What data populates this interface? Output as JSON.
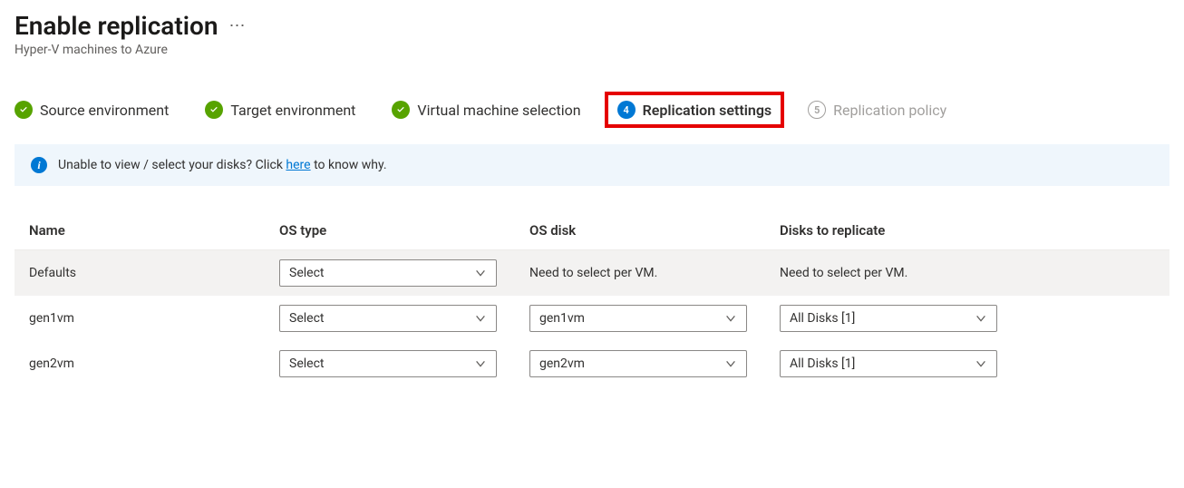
{
  "header": {
    "title": "Enable replication",
    "subtitle": "Hyper-V machines to Azure"
  },
  "steps": [
    {
      "label": "Source environment",
      "state": "done"
    },
    {
      "label": "Target environment",
      "state": "done"
    },
    {
      "label": "Virtual machine selection",
      "state": "done"
    },
    {
      "label": "Replication settings",
      "state": "current",
      "num": "4"
    },
    {
      "label": "Replication policy",
      "state": "disabled",
      "num": "5"
    }
  ],
  "banner": {
    "text_before": "Unable to view / select your disks? Click ",
    "link": "here",
    "text_after": " to know why."
  },
  "table": {
    "columns": {
      "name": "Name",
      "os_type": "OS type",
      "os_disk": "OS disk",
      "disks": "Disks to replicate"
    },
    "defaults": {
      "name": "Defaults",
      "os_type": "Select",
      "os_disk": "Need to select per VM.",
      "disks": "Need to select per VM."
    },
    "rows": [
      {
        "name": "gen1vm",
        "os_type": "Select",
        "os_disk": "gen1vm",
        "disks": "All Disks [1]"
      },
      {
        "name": "gen2vm",
        "os_type": "Select",
        "os_disk": "gen2vm",
        "disks": "All Disks [1]"
      }
    ]
  }
}
